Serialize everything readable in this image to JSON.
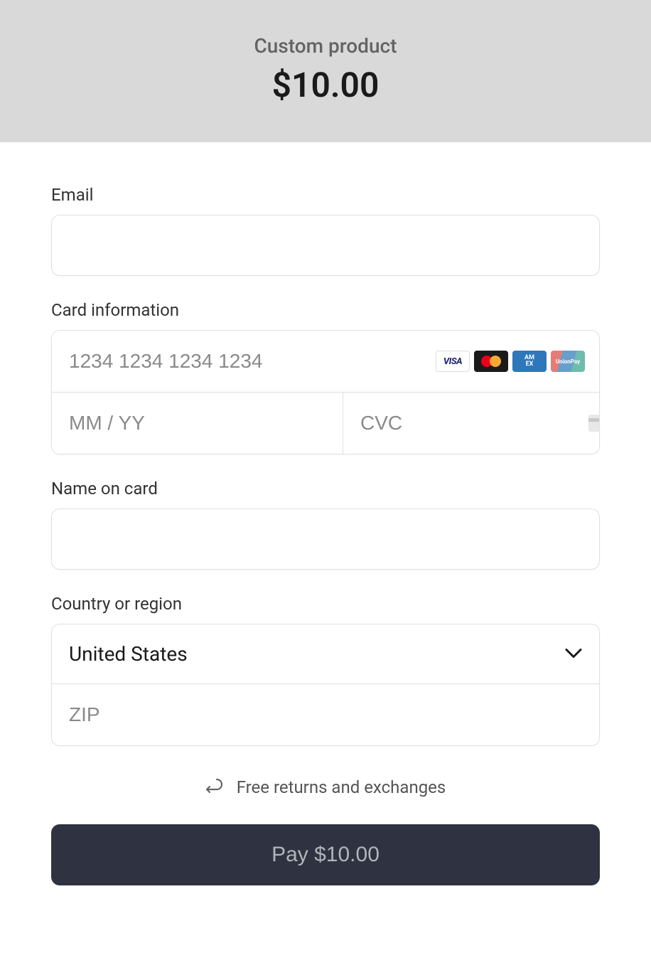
{
  "header": {
    "product_name": "Custom product",
    "product_price": "$10.00"
  },
  "form": {
    "email_label": "Email",
    "card_info_label": "Card information",
    "card_number_placeholder": "1234 1234 1234 1234",
    "card_expiry_placeholder": "MM / YY",
    "card_cvc_placeholder": "CVC",
    "name_label": "Name on card",
    "country_label": "Country or region",
    "country_value": "United States",
    "zip_placeholder": "ZIP"
  },
  "returns": {
    "text": "Free returns and exchanges"
  },
  "pay_button": {
    "label": "Pay $10.00"
  }
}
